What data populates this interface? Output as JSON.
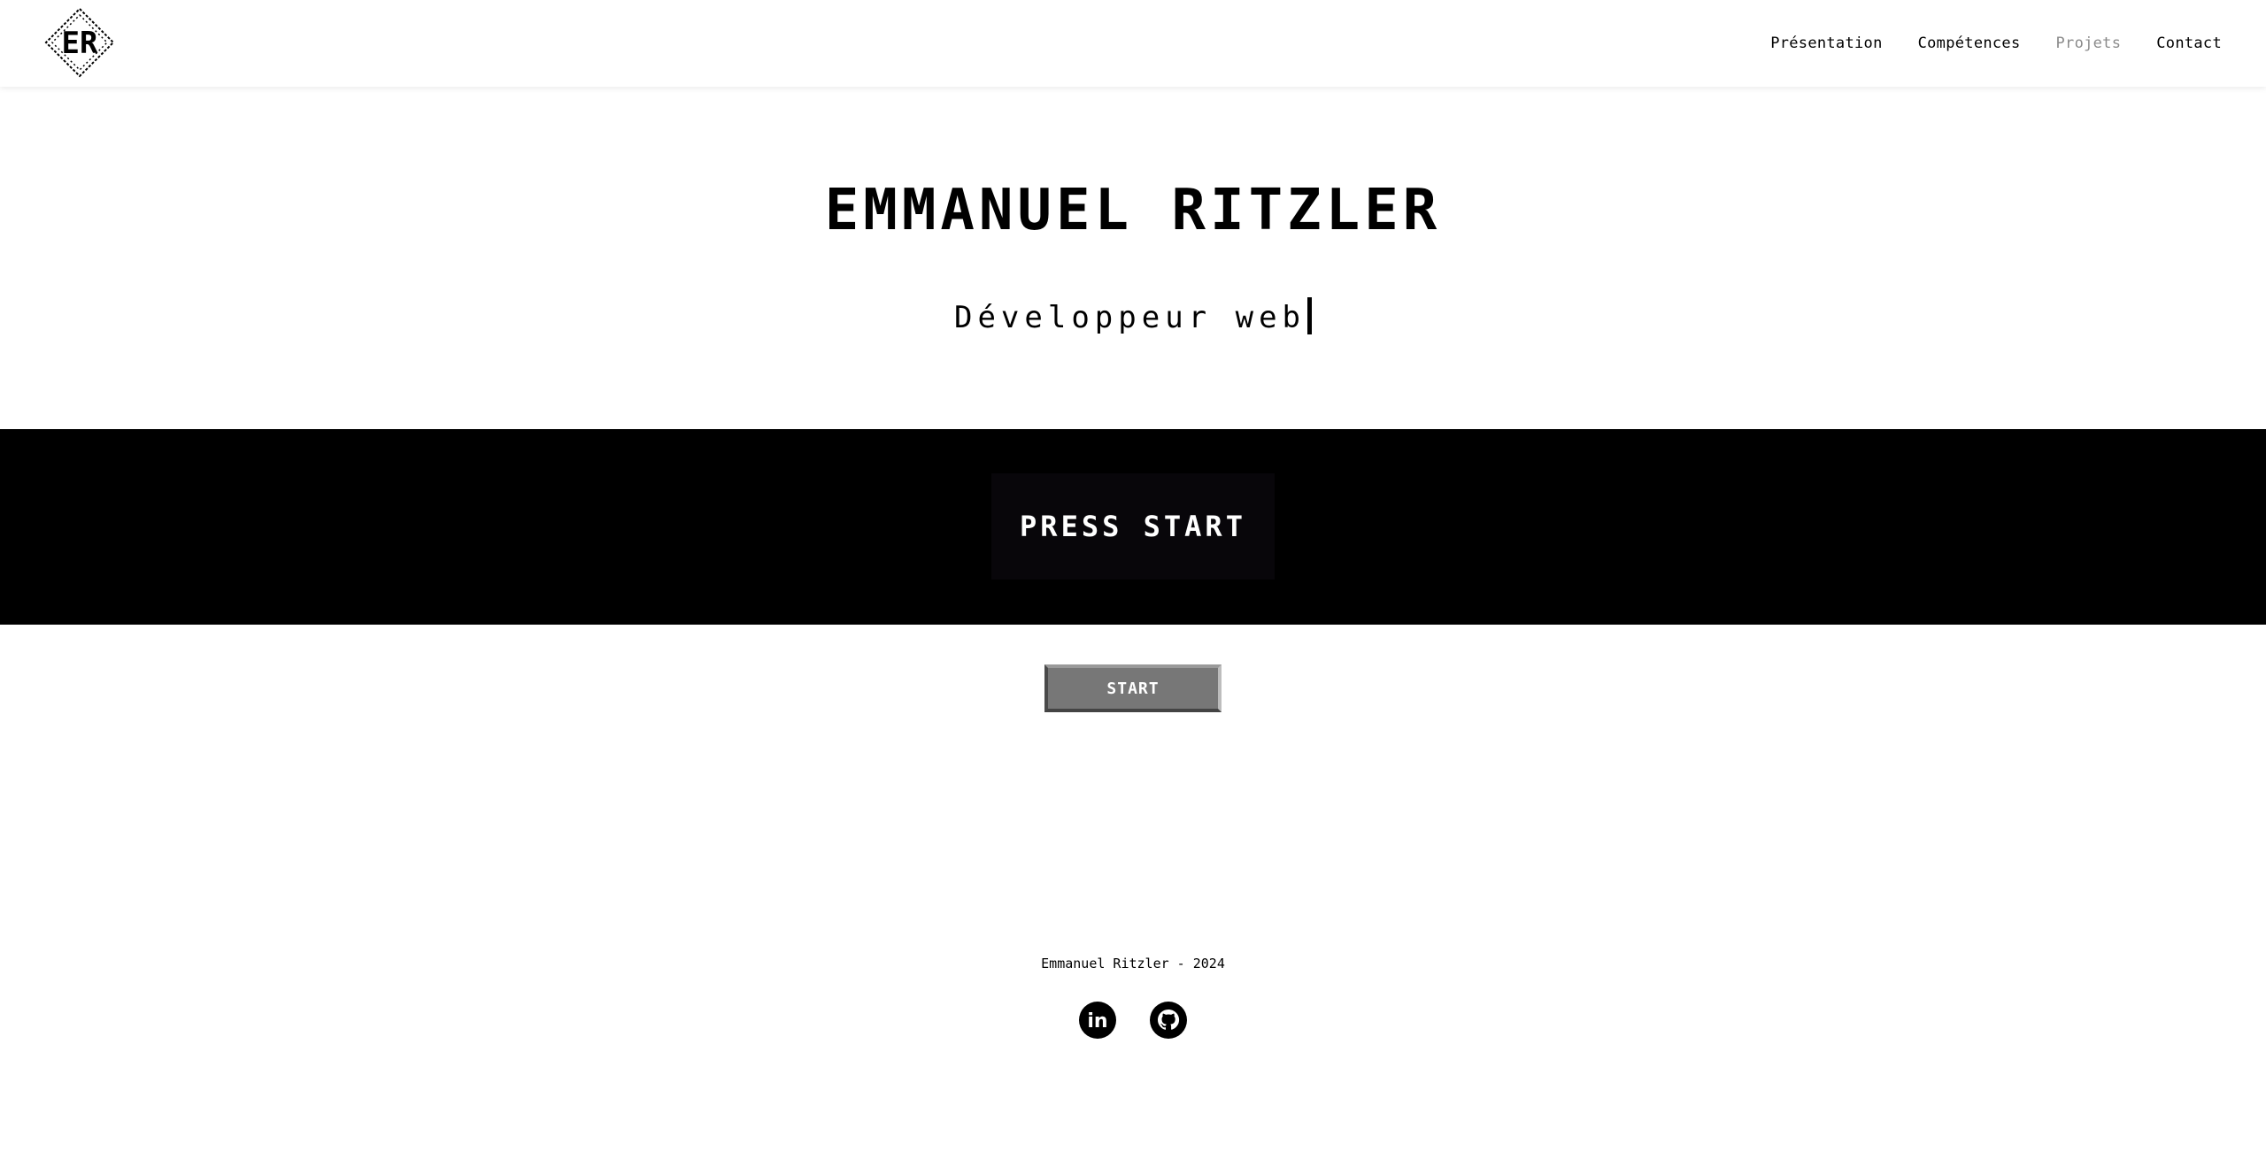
{
  "header": {
    "logo_text": "ER",
    "nav": [
      {
        "label": "Présentation"
      },
      {
        "label": "Compétences"
      },
      {
        "label": "Projets"
      },
      {
        "label": "Contact"
      }
    ]
  },
  "hero": {
    "title": "EMMANUEL RITZLER",
    "subtitle": "Développeur web"
  },
  "band": {
    "press_start": "PRESS START"
  },
  "start_button": {
    "label": "START"
  },
  "footer": {
    "copyright": "Emmanuel Ritzler - 2024",
    "socials": [
      {
        "icon": "linkedin-icon",
        "text": "in"
      },
      {
        "icon": "github-icon"
      }
    ]
  },
  "colors": {
    "background": "#ffffff",
    "text": "#000000",
    "nav_muted": "#8a8a8a",
    "band": "#000000",
    "button": "#777777"
  }
}
